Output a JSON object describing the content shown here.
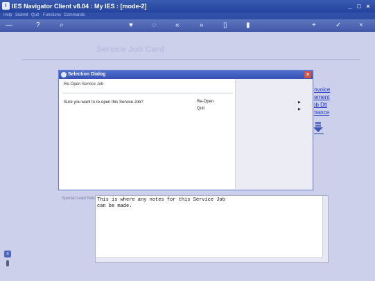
{
  "window": {
    "title": "IES Navigator Client v8.04 : My IES :        [mode-2]",
    "controls": {
      "minimize": "_",
      "maximize": "□",
      "close": "×"
    }
  },
  "menu": {
    "items": [
      "Help",
      "Submit",
      "Quit",
      "Functions",
      "Commands"
    ]
  },
  "toolbar": {
    "icons": [
      "key-icon",
      "help-icon",
      "search-icon",
      "heart-icon",
      "refresh-icon",
      "back-icon",
      "forward-icon",
      "document-icon",
      "page-icon",
      "add-icon",
      "check-icon",
      "close-icon"
    ],
    "glyphs": [
      "—",
      "?",
      "⌕",
      "♥",
      "◌",
      "«",
      "»",
      "▯",
      "▮",
      "+",
      "✓",
      "×"
    ]
  },
  "form": {
    "title": "Service Job Card",
    "links": [
      "Invoice",
      "tement",
      "ob Dtl",
      "mance"
    ],
    "notes_label": "Special Lead Notes",
    "notes_text": "This is where any notes for this Service Job\ncan be made."
  },
  "dialog": {
    "title": "Selection Dialog",
    "subtitle": "Re-Open Service Job",
    "question": "Sure you want to re-open this Service Job?",
    "options": [
      {
        "label": "Re-Open",
        "arrow": "▶"
      },
      {
        "label": "Quit",
        "arrow": "▶"
      }
    ],
    "close_glyph": "×"
  },
  "colors": {
    "title_bar": "#2443a0",
    "background": "#cdd0e8",
    "link": "#1c33c8",
    "dialog_close": "#d9533a"
  }
}
